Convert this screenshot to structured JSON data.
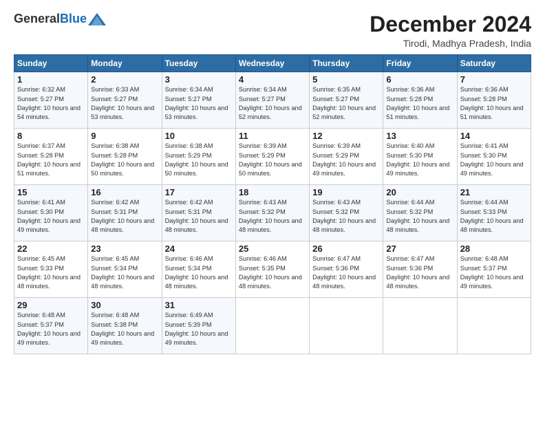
{
  "header": {
    "logo_general": "General",
    "logo_blue": "Blue",
    "title": "December 2024",
    "subtitle": "Tirodi, Madhya Pradesh, India"
  },
  "weekdays": [
    "Sunday",
    "Monday",
    "Tuesday",
    "Wednesday",
    "Thursday",
    "Friday",
    "Saturday"
  ],
  "weeks": [
    [
      {
        "day": "1",
        "sunrise": "6:32 AM",
        "sunset": "5:27 PM",
        "daylight": "10 hours and 54 minutes."
      },
      {
        "day": "2",
        "sunrise": "6:33 AM",
        "sunset": "5:27 PM",
        "daylight": "10 hours and 53 minutes."
      },
      {
        "day": "3",
        "sunrise": "6:34 AM",
        "sunset": "5:27 PM",
        "daylight": "10 hours and 53 minutes."
      },
      {
        "day": "4",
        "sunrise": "6:34 AM",
        "sunset": "5:27 PM",
        "daylight": "10 hours and 52 minutes."
      },
      {
        "day": "5",
        "sunrise": "6:35 AM",
        "sunset": "5:27 PM",
        "daylight": "10 hours and 52 minutes."
      },
      {
        "day": "6",
        "sunrise": "6:36 AM",
        "sunset": "5:28 PM",
        "daylight": "10 hours and 51 minutes."
      },
      {
        "day": "7",
        "sunrise": "6:36 AM",
        "sunset": "5:28 PM",
        "daylight": "10 hours and 51 minutes."
      }
    ],
    [
      {
        "day": "8",
        "sunrise": "6:37 AM",
        "sunset": "5:28 PM",
        "daylight": "10 hours and 51 minutes."
      },
      {
        "day": "9",
        "sunrise": "6:38 AM",
        "sunset": "5:28 PM",
        "daylight": "10 hours and 50 minutes."
      },
      {
        "day": "10",
        "sunrise": "6:38 AM",
        "sunset": "5:29 PM",
        "daylight": "10 hours and 50 minutes."
      },
      {
        "day": "11",
        "sunrise": "6:39 AM",
        "sunset": "5:29 PM",
        "daylight": "10 hours and 50 minutes."
      },
      {
        "day": "12",
        "sunrise": "6:39 AM",
        "sunset": "5:29 PM",
        "daylight": "10 hours and 49 minutes."
      },
      {
        "day": "13",
        "sunrise": "6:40 AM",
        "sunset": "5:30 PM",
        "daylight": "10 hours and 49 minutes."
      },
      {
        "day": "14",
        "sunrise": "6:41 AM",
        "sunset": "5:30 PM",
        "daylight": "10 hours and 49 minutes."
      }
    ],
    [
      {
        "day": "15",
        "sunrise": "6:41 AM",
        "sunset": "5:30 PM",
        "daylight": "10 hours and 49 minutes."
      },
      {
        "day": "16",
        "sunrise": "6:42 AM",
        "sunset": "5:31 PM",
        "daylight": "10 hours and 48 minutes."
      },
      {
        "day": "17",
        "sunrise": "6:42 AM",
        "sunset": "5:31 PM",
        "daylight": "10 hours and 48 minutes."
      },
      {
        "day": "18",
        "sunrise": "6:43 AM",
        "sunset": "5:32 PM",
        "daylight": "10 hours and 48 minutes."
      },
      {
        "day": "19",
        "sunrise": "6:43 AM",
        "sunset": "5:32 PM",
        "daylight": "10 hours and 48 minutes."
      },
      {
        "day": "20",
        "sunrise": "6:44 AM",
        "sunset": "5:32 PM",
        "daylight": "10 hours and 48 minutes."
      },
      {
        "day": "21",
        "sunrise": "6:44 AM",
        "sunset": "5:33 PM",
        "daylight": "10 hours and 48 minutes."
      }
    ],
    [
      {
        "day": "22",
        "sunrise": "6:45 AM",
        "sunset": "5:33 PM",
        "daylight": "10 hours and 48 minutes."
      },
      {
        "day": "23",
        "sunrise": "6:45 AM",
        "sunset": "5:34 PM",
        "daylight": "10 hours and 48 minutes."
      },
      {
        "day": "24",
        "sunrise": "6:46 AM",
        "sunset": "5:34 PM",
        "daylight": "10 hours and 48 minutes."
      },
      {
        "day": "25",
        "sunrise": "6:46 AM",
        "sunset": "5:35 PM",
        "daylight": "10 hours and 48 minutes."
      },
      {
        "day": "26",
        "sunrise": "6:47 AM",
        "sunset": "5:36 PM",
        "daylight": "10 hours and 48 minutes."
      },
      {
        "day": "27",
        "sunrise": "6:47 AM",
        "sunset": "5:36 PM",
        "daylight": "10 hours and 48 minutes."
      },
      {
        "day": "28",
        "sunrise": "6:48 AM",
        "sunset": "5:37 PM",
        "daylight": "10 hours and 49 minutes."
      }
    ],
    [
      {
        "day": "29",
        "sunrise": "6:48 AM",
        "sunset": "5:37 PM",
        "daylight": "10 hours and 49 minutes."
      },
      {
        "day": "30",
        "sunrise": "6:48 AM",
        "sunset": "5:38 PM",
        "daylight": "10 hours and 49 minutes."
      },
      {
        "day": "31",
        "sunrise": "6:49 AM",
        "sunset": "5:39 PM",
        "daylight": "10 hours and 49 minutes."
      },
      null,
      null,
      null,
      null
    ]
  ]
}
